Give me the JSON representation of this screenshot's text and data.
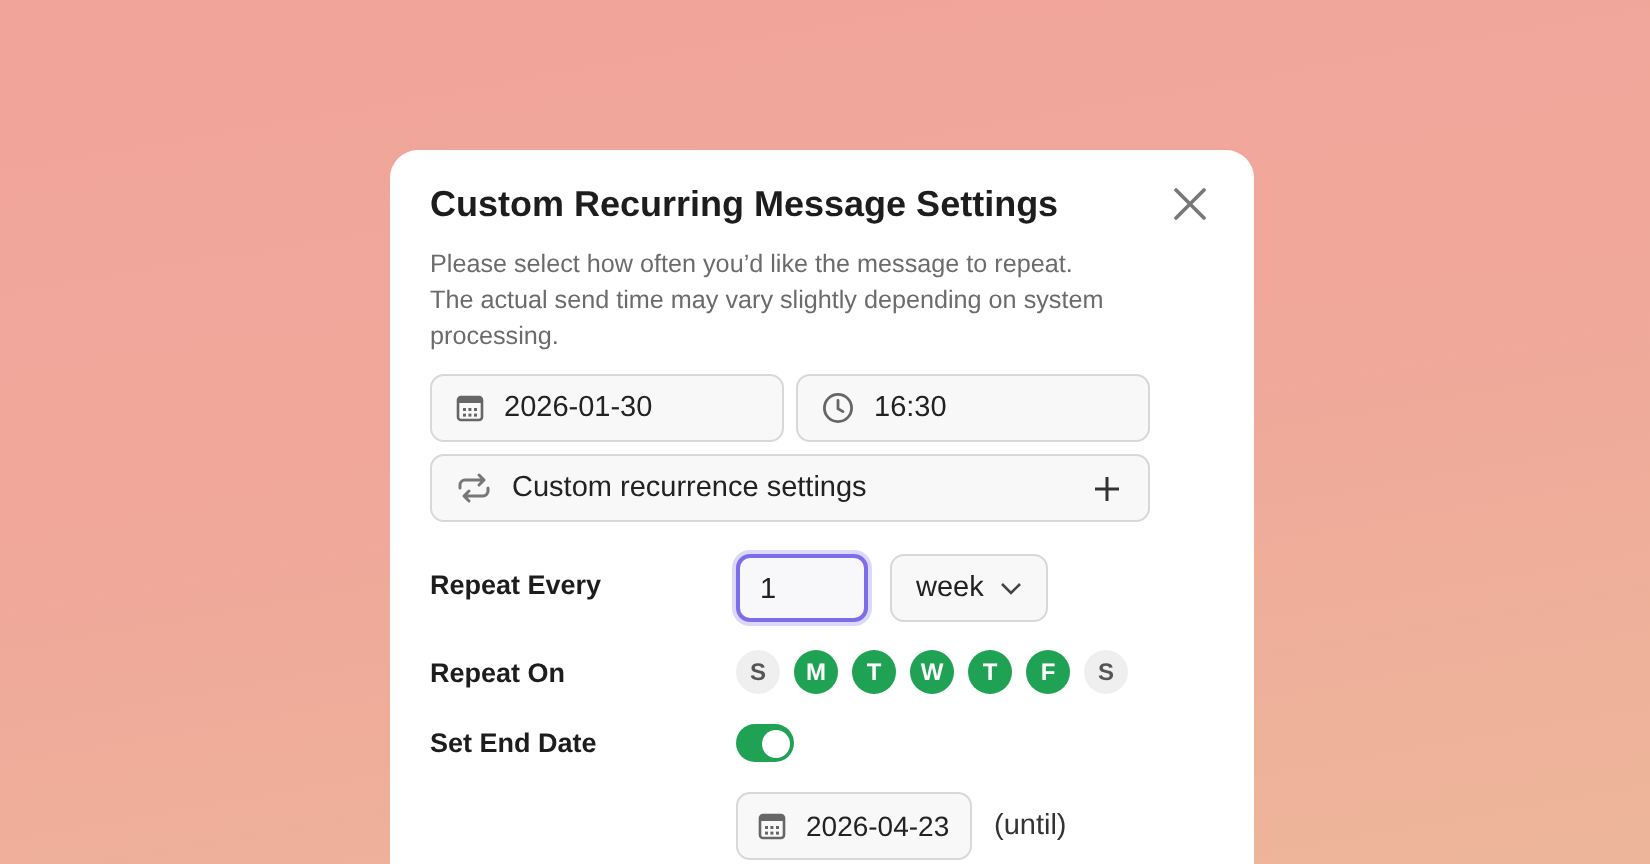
{
  "dialog": {
    "title": "Custom Recurring Message Settings",
    "description": "Please select how often you’d like the message to repeat. The actual send time may vary slightly depending on system processing.",
    "date": "2026-01-30",
    "time": "16:30",
    "custom_settings": "Custom recurrence settings",
    "repeat_every": {
      "label": "Repeat Every",
      "value": "1",
      "unit": "week",
      "focused": true
    },
    "repeat_on": {
      "label": "Repeat On",
      "days": [
        {
          "label": "S",
          "selected": false
        },
        {
          "label": "M",
          "selected": true
        },
        {
          "label": "T",
          "selected": true
        },
        {
          "label": "W",
          "selected": true
        },
        {
          "label": "T",
          "selected": true
        },
        {
          "label": "F",
          "selected": true
        },
        {
          "label": "S",
          "selected": false
        }
      ]
    },
    "end_date": {
      "label": "Set End Date",
      "on": true,
      "date": "2026-04-23",
      "suffix": "(until)"
    }
  }
}
